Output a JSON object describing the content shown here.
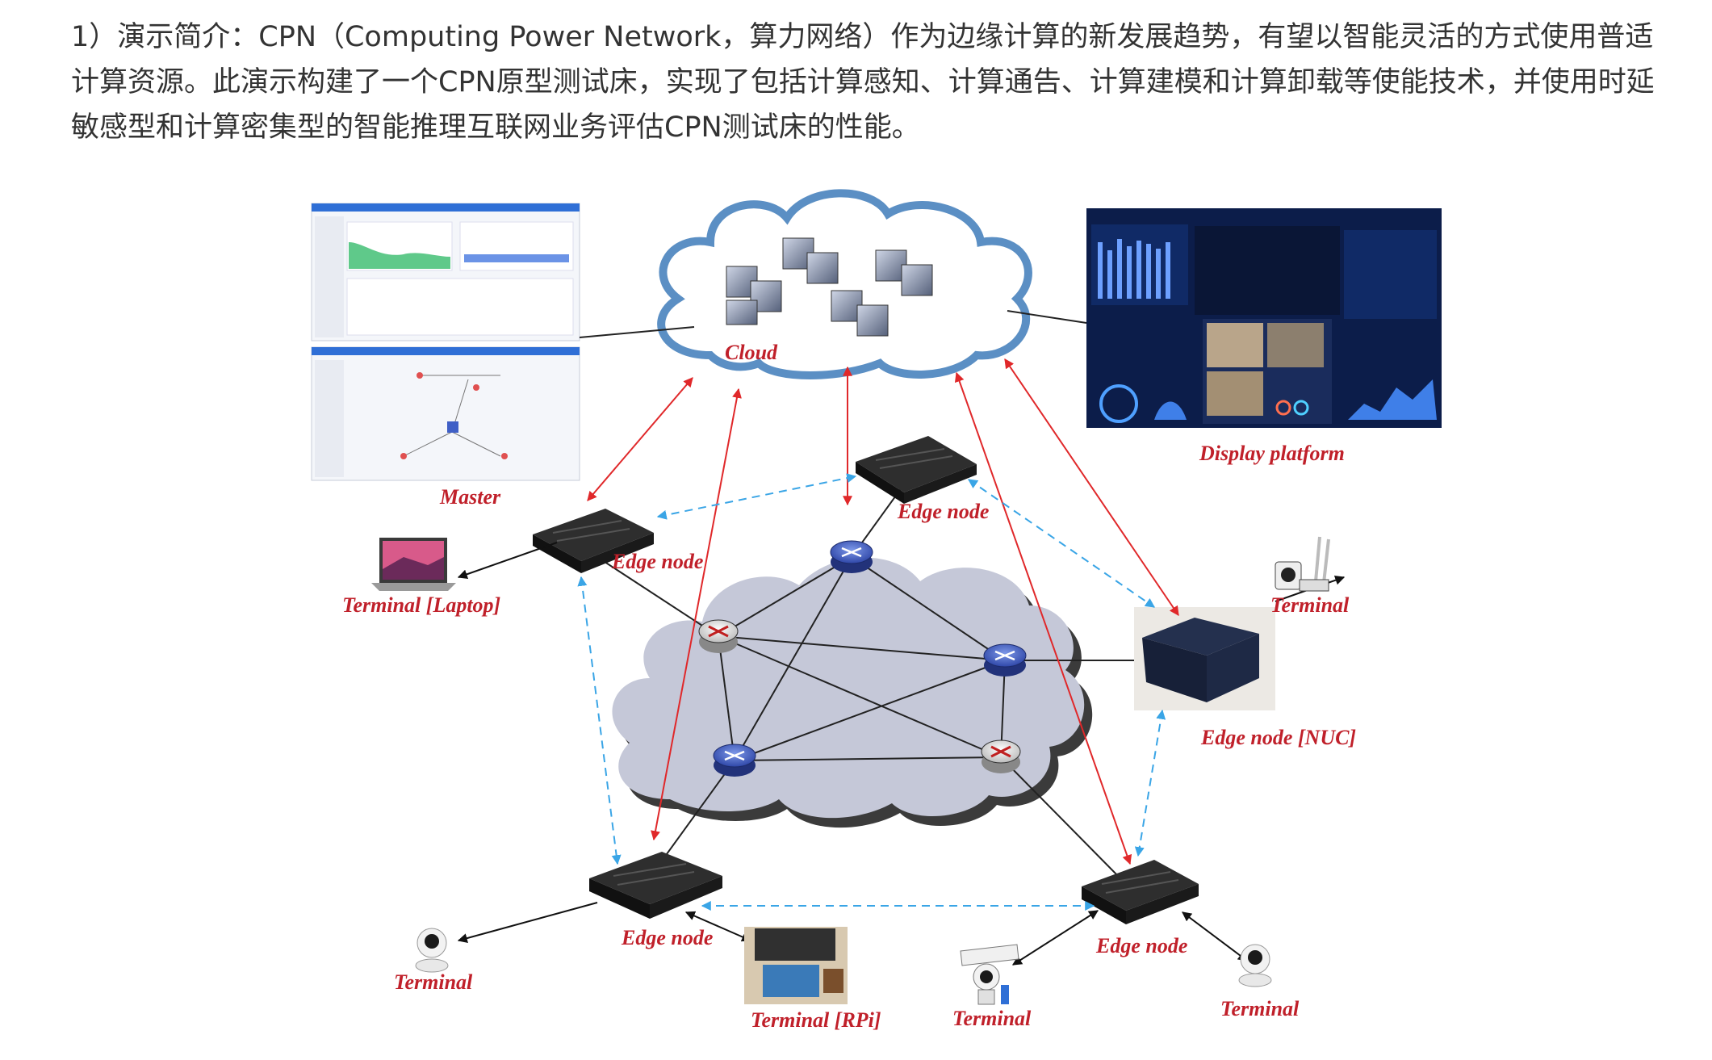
{
  "intro": {
    "text": "1）演示简介：CPN（Computing Power Network，算力网络）作为边缘计算的新发展趋势，有望以智能灵活的方式使用普适计算资源。此演示构建了一个CPN原型测试床，实现了包括计算感知、计算通告、计算建模和计算卸载等使能技术，并使用时延敏感型和计算密集型的智能推理互联网业务评估CPN测试床的性能。"
  },
  "labels": {
    "cloud": "Cloud",
    "master": "Master",
    "display": "Display platform",
    "edge_top": "Edge node",
    "edge_left": "Edge node",
    "edge_nuc": "Edge node [NUC]",
    "edge_bl": "Edge node",
    "edge_br": "Edge node",
    "term_laptop": "Terminal [Laptop]",
    "term_right": "Terminal",
    "term_bl": "Terminal",
    "term_rpi": "Terminal [RPi]",
    "term_cam": "Terminal",
    "term_br": "Terminal"
  },
  "colors": {
    "cloud_stroke": "#5b8fc4",
    "network_cloud": "#c5c8d8",
    "red_link": "#e0282a",
    "blue_dashed": "#3aa5e6",
    "label_red": "#c0202a",
    "router_blue": "#3f5fc6"
  }
}
